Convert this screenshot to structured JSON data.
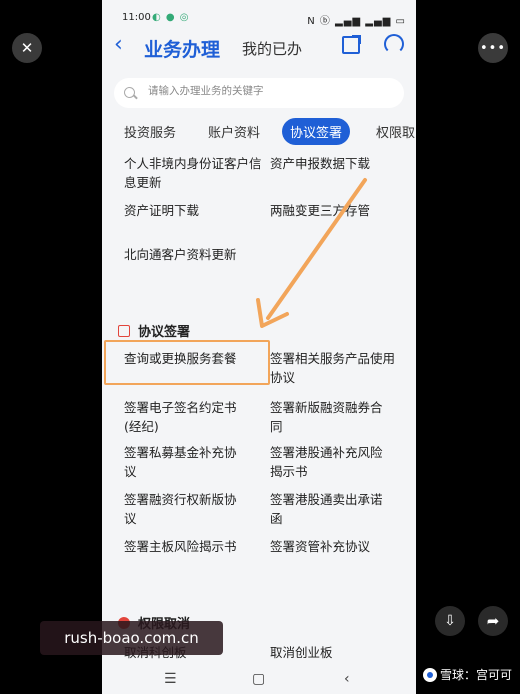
{
  "status_bar": {
    "time": "11:00",
    "indicators": "◐ ● ◎",
    "right": "N ⓑ ▂▄▆ ▂▄▆ ▭"
  },
  "header": {
    "back_icon": "‹",
    "title": "业务办理",
    "mine": "我的已办"
  },
  "search": {
    "placeholder": "请输入办理业务的关键字"
  },
  "tabs": [
    {
      "label": "投资服务"
    },
    {
      "label": "账户资料"
    },
    {
      "label": "协议签署"
    },
    {
      "label": "权限取"
    }
  ],
  "account_items": [
    "个人非境内身份证客户信息更新",
    "资产申报数据下载",
    "资产证明下载",
    "两融变更三方存管",
    "北向通客户资料更新"
  ],
  "agreement_section": {
    "title": "协议签署",
    "items": [
      "查询或更换服务套餐",
      "签署相关服务产品使用协议",
      "签署电子签名约定书(经纪)",
      "签署新版融资融券合同",
      "签署私募基金补充协议",
      "签署港股通补充风险揭示书",
      "签署融资行权新版协议",
      "签署港股通卖出承诺函",
      "签署主板风险揭示书",
      "签署资管补充协议"
    ]
  },
  "permission_section": {
    "title": "权限取消",
    "items": [
      "取消科创板",
      "取消创业板"
    ]
  },
  "nav": {
    "menu": "☰",
    "home": "▢",
    "back": "‹"
  },
  "overlay": {
    "close_icon": "✕",
    "more_icon": "•••",
    "save_icon": "⇩",
    "share_icon": "➦",
    "watermark": "rush-boao.com.cn",
    "brand": "雪球：宫可可",
    "highlight_color": "#f2a55a"
  }
}
